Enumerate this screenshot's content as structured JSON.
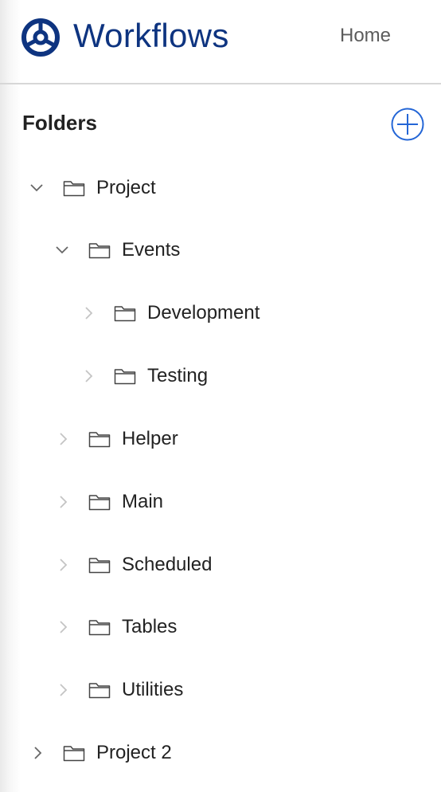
{
  "header": {
    "app_title": "Workflows",
    "home_label": "Home",
    "brand_color": "#0e3480",
    "logo_icon": "steering-wheel-icon"
  },
  "sidebar": {
    "heading": "Folders",
    "add_icon": "plus-circle-icon",
    "accent_color": "#2466d6",
    "tree": [
      {
        "label": "Project",
        "depth": 0,
        "state": "expanded"
      },
      {
        "label": "Events",
        "depth": 1,
        "state": "expanded"
      },
      {
        "label": "Development",
        "depth": 2,
        "state": "collapsed"
      },
      {
        "label": "Testing",
        "depth": 2,
        "state": "collapsed"
      },
      {
        "label": "Helper",
        "depth": 1,
        "state": "collapsed"
      },
      {
        "label": "Main",
        "depth": 1,
        "state": "collapsed"
      },
      {
        "label": "Scheduled",
        "depth": 1,
        "state": "collapsed"
      },
      {
        "label": "Tables",
        "depth": 1,
        "state": "collapsed"
      },
      {
        "label": "Utilities",
        "depth": 1,
        "state": "collapsed"
      },
      {
        "label": "Project 2",
        "depth": 0,
        "state": "collapsed"
      }
    ]
  }
}
